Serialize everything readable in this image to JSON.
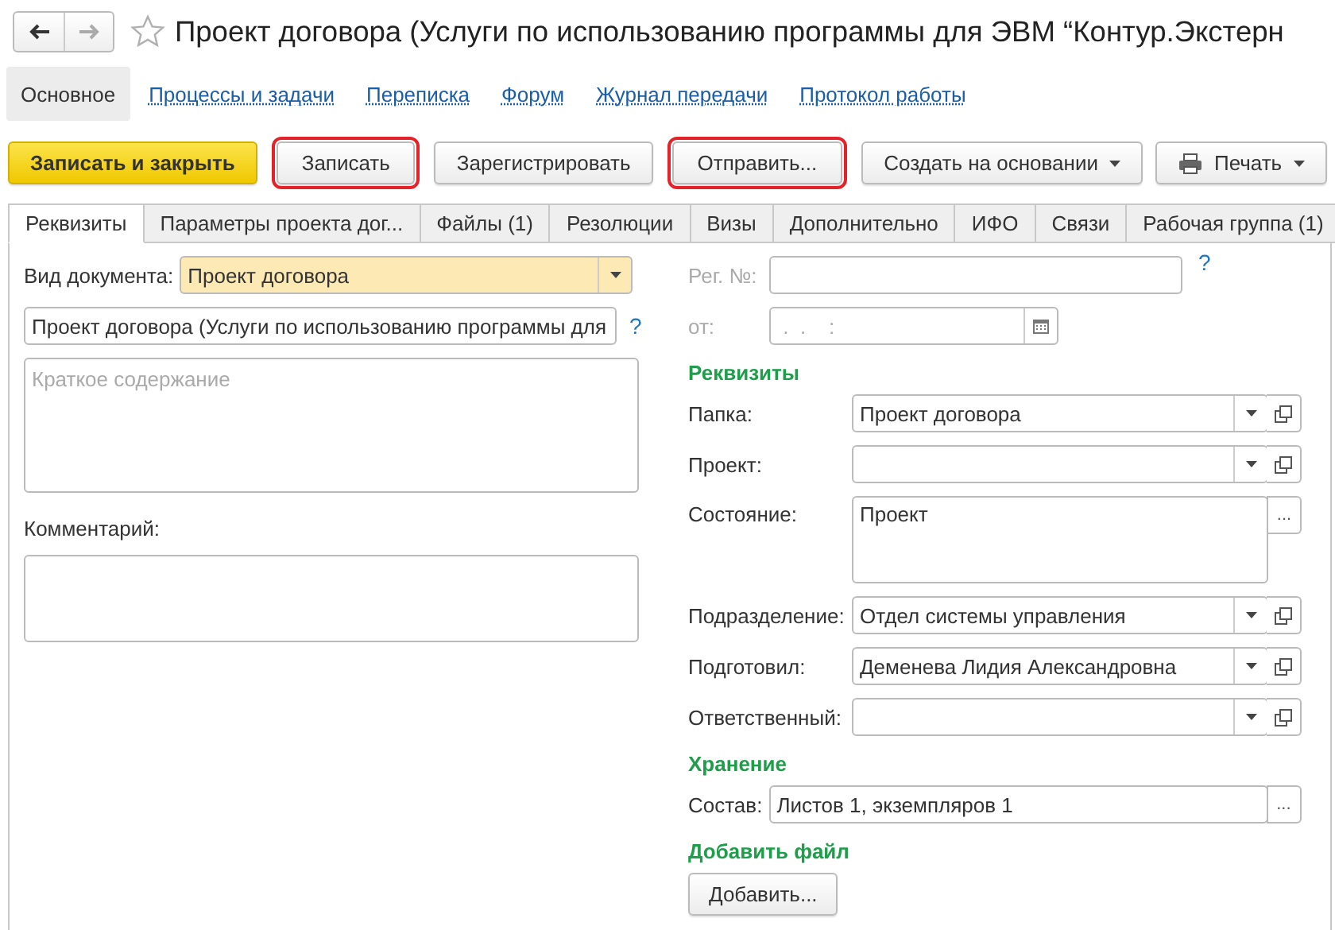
{
  "window": {
    "title": "Проект договора (Услуги по использованию программы для ЭВМ “Контур.Экстерн",
    "favorite": false
  },
  "nav": [
    {
      "kind": "back",
      "disabled": false
    },
    {
      "kind": "forward",
      "disabled": true
    }
  ],
  "sections": [
    {
      "label": "Основное",
      "selected": true
    },
    {
      "label": "Процессы и задачи",
      "selected": false
    },
    {
      "label": "Переписка",
      "selected": false
    },
    {
      "label": "Форум",
      "selected": false
    },
    {
      "label": "Журнал передачи",
      "selected": false
    },
    {
      "label": "Протокол работы",
      "selected": false
    }
  ],
  "toolbar": [
    {
      "label": "Записать и закрыть",
      "kind": "primary",
      "highlighted": false,
      "dropdown": false
    },
    {
      "label": "Записать",
      "kind": "normal",
      "highlighted": true,
      "dropdown": false
    },
    {
      "label": "Зарегистрировать",
      "kind": "normal",
      "highlighted": false,
      "dropdown": false
    },
    {
      "label": "Отправить...",
      "kind": "normal",
      "highlighted": true,
      "dropdown": false
    },
    {
      "label": "Создать на основании",
      "kind": "normal",
      "highlighted": false,
      "dropdown": true
    },
    {
      "label": "Печать",
      "kind": "print",
      "highlighted": false,
      "dropdown": true
    }
  ],
  "tabs": [
    {
      "label": "Реквизиты",
      "selected": true
    },
    {
      "label": "Параметры проекта дог...",
      "selected": false
    },
    {
      "label": "Файлы (1)",
      "selected": false
    },
    {
      "label": "Резолюции",
      "selected": false
    },
    {
      "label": "Визы",
      "selected": false
    },
    {
      "label": "Дополнительно",
      "selected": false
    },
    {
      "label": "ИФО",
      "selected": false
    },
    {
      "label": "Связи",
      "selected": false
    },
    {
      "label": "Рабочая группа (1)",
      "selected": false
    }
  ],
  "left": {
    "doc_type": {
      "label": "Вид документа:",
      "value": "Проект договора"
    },
    "name_field": {
      "value": "Проект договора (Услуги по использованию программы для",
      "help": "?"
    },
    "summary": {
      "placeholder": "Краткое содержание"
    },
    "comment": {
      "label": "Комментарий:"
    }
  },
  "right": {
    "reg_no": {
      "label": "Рег. №:",
      "help": "?",
      "disabled": true
    },
    "date": {
      "label": "от:",
      "placeholder": " .  .    :",
      "disabled": true
    },
    "groups": [
      {
        "title": "Реквизиты",
        "fields": [
          {
            "label": "Папка:",
            "value": "Проект договора",
            "kind": "select"
          },
          {
            "label": "Проект:",
            "kind": "select"
          },
          {
            "label": "Состояние:",
            "value": "Проект",
            "kind": "memo",
            "action": "..."
          },
          {
            "label": "Подразделение:",
            "value": "Отдел системы управления",
            "kind": "select"
          },
          {
            "label": "Подготовил:",
            "value": "Деменева Лидия Александровна",
            "kind": "select"
          },
          {
            "label": "Ответственный:",
            "kind": "select"
          }
        ]
      },
      {
        "title": "Хранение",
        "fields": [
          {
            "label": "Состав:",
            "value": "Листов 1, экземпляров 1",
            "kind": "choice",
            "action": "..."
          }
        ]
      },
      {
        "title": "Добавить файл",
        "fields": [
          {
            "label": "Добавить...",
            "kind": "button"
          }
        ]
      }
    ]
  }
}
